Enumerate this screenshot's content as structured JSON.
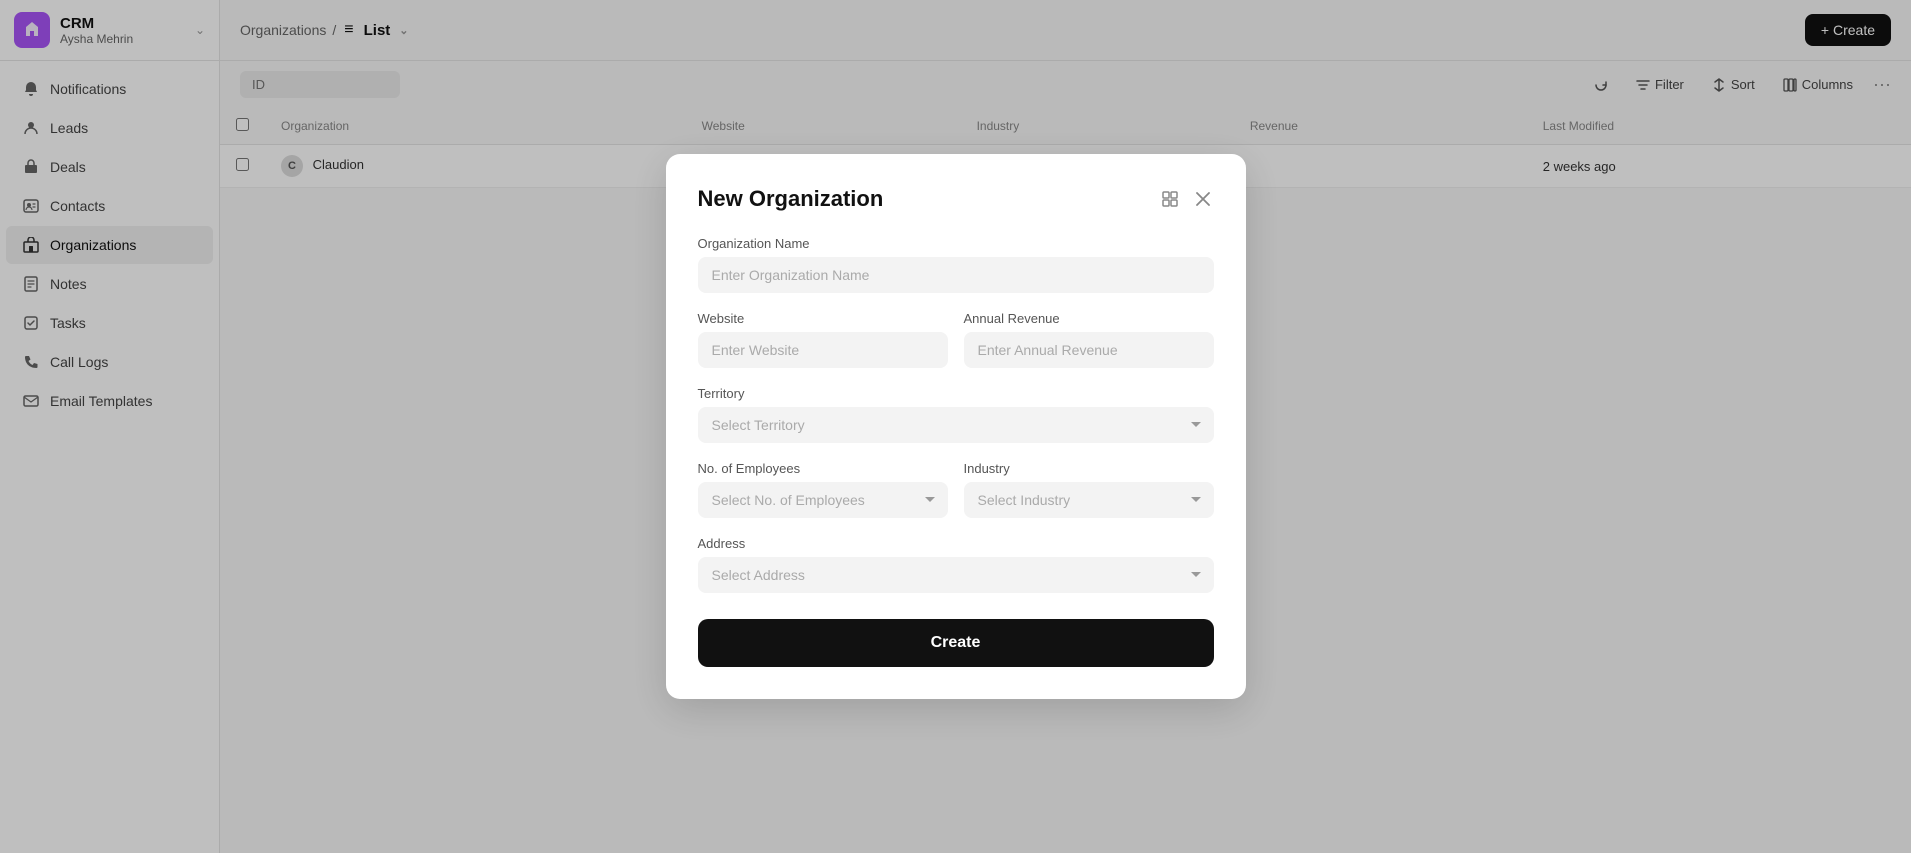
{
  "sidebar": {
    "logo_letter": "▼",
    "brand_name": "CRM",
    "user_name": "Aysha Mehrin",
    "chevron": "⌄",
    "items": [
      {
        "id": "notifications",
        "label": "Notifications",
        "icon": "🔔",
        "active": false
      },
      {
        "id": "leads",
        "label": "Leads",
        "icon": "👤",
        "active": false
      },
      {
        "id": "deals",
        "label": "Deals",
        "icon": "💼",
        "active": false
      },
      {
        "id": "contacts",
        "label": "Contacts",
        "icon": "📇",
        "active": false
      },
      {
        "id": "organizations",
        "label": "Organizations",
        "icon": "🏢",
        "active": true
      },
      {
        "id": "notes",
        "label": "Notes",
        "icon": "📝",
        "active": false
      },
      {
        "id": "tasks",
        "label": "Tasks",
        "icon": "✅",
        "active": false
      },
      {
        "id": "call-logs",
        "label": "Call Logs",
        "icon": "📞",
        "active": false
      },
      {
        "id": "email-templates",
        "label": "Email Templates",
        "icon": "✉️",
        "active": false
      }
    ]
  },
  "topbar": {
    "breadcrumb_parent": "Organizations",
    "breadcrumb_sep": "/",
    "list_icon": "≡",
    "view_label": "List",
    "view_chevron": "⌄",
    "create_label": "+ Create"
  },
  "toolbar": {
    "id_placeholder": "ID",
    "refresh_icon": "↻",
    "filter_label": "Filter",
    "sort_label": "Sort",
    "columns_label": "Columns",
    "more_icon": "···"
  },
  "table": {
    "columns": [
      "Organization",
      "Website",
      "Industry",
      "Revenue",
      "Last Modified"
    ],
    "rows": [
      {
        "initial": "C",
        "name": "Claudion",
        "website": "",
        "industry": "",
        "revenue": "",
        "last_modified": "2 weeks ago"
      }
    ]
  },
  "modal": {
    "title": "New Organization",
    "open_icon": "⬚",
    "close_icon": "✕",
    "org_name_label": "Organization Name",
    "org_name_placeholder": "Enter Organization Name",
    "website_label": "Website",
    "website_placeholder": "Enter Website",
    "annual_revenue_label": "Annual Revenue",
    "annual_revenue_placeholder": "Enter Annual Revenue",
    "territory_label": "Territory",
    "territory_placeholder": "Select Territory",
    "employees_label": "No. of Employees",
    "employees_placeholder": "Select No. of Employees",
    "industry_label": "Industry",
    "industry_placeholder": "Select Industry",
    "address_label": "Address",
    "address_placeholder": "Select Address",
    "create_btn_label": "Create"
  }
}
